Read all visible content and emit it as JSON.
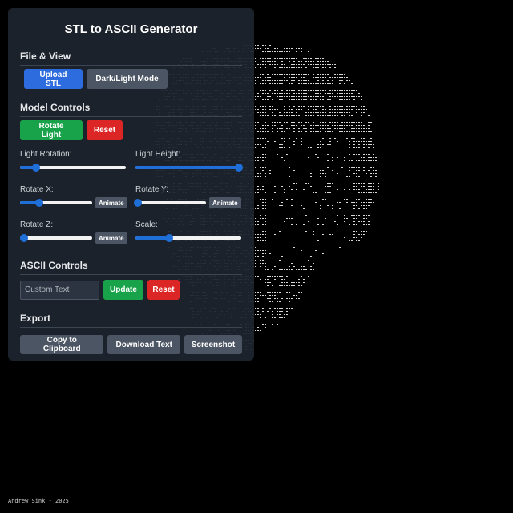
{
  "app": {
    "title": "STL to ASCII Generator"
  },
  "file_view": {
    "section_title": "File & View",
    "upload_label": "Upload STL",
    "theme_label": "Dark/Light Mode"
  },
  "model_controls": {
    "section_title": "Model Controls",
    "rotate_light_label": "Rotate Light",
    "reset_label": "Reset",
    "sliders": [
      {
        "label": "Light Rotation:",
        "value": 0.15,
        "animate": false
      },
      {
        "label": "Light Height:",
        "value": 0.98,
        "animate": false
      },
      {
        "label": "Rotate X:",
        "value": 0.27,
        "animate": true
      },
      {
        "label": "Rotate Y:",
        "value": 0.03,
        "animate": true
      },
      {
        "label": "Rotate Z:",
        "value": 0.05,
        "animate": true
      },
      {
        "label": "Scale:",
        "value": 0.32,
        "animate": false
      }
    ],
    "animate_label": "Animate"
  },
  "ascii_controls": {
    "section_title": "ASCII Controls",
    "custom_text_placeholder": "Custom Text",
    "update_label": "Update",
    "reset_label": "Reset"
  },
  "export": {
    "section_title": "Export",
    "copy_label": "Copy to Clipboard",
    "download_label": "Download Text",
    "screenshot_label": "Screenshot"
  },
  "footer": {
    "credit": "Andrew Sink - 2025"
  },
  "colors": {
    "panel_bg": "#1e242e",
    "accent_blue": "#2d6cdf",
    "accent_green": "#18a34a",
    "accent_red": "#dc2626",
    "neutral_button": "#4b5563",
    "slider_accent": "#1f6fd9"
  }
}
